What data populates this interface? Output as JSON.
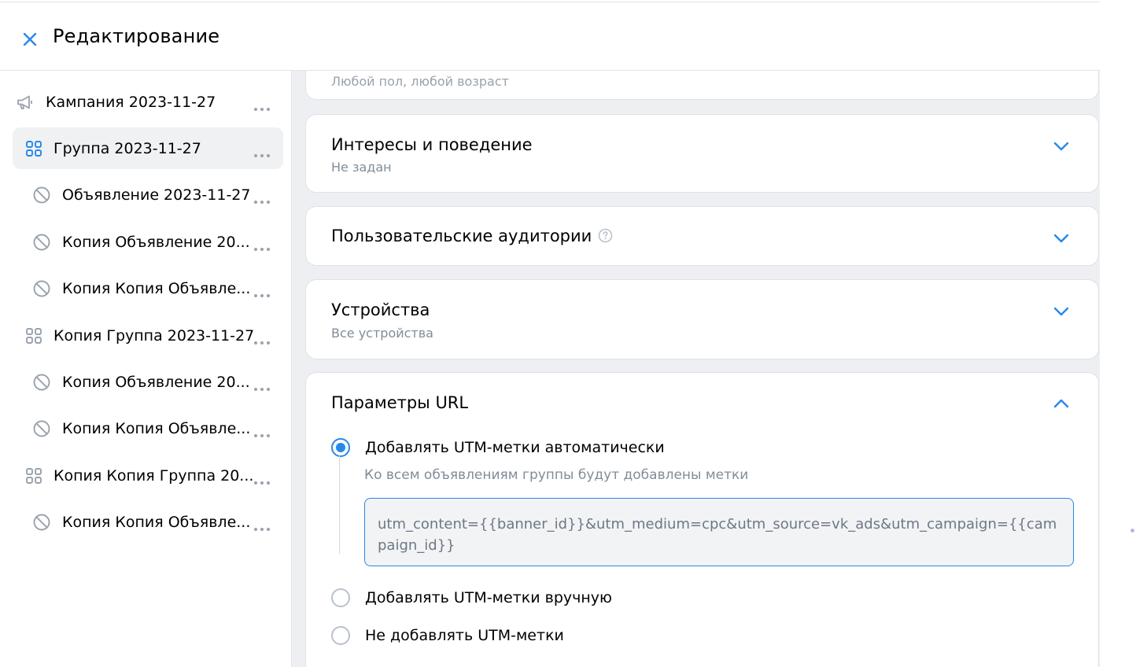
{
  "header": {
    "title": "Редактирование"
  },
  "sidebar": {
    "items": [
      {
        "label": "Кампания 2023-11-27",
        "icon": "megaphone-icon",
        "active": false
      },
      {
        "label": "Группа 2023-11-27",
        "icon": "grid-icon",
        "active": true
      },
      {
        "label": "Объявление 2023-11-27",
        "icon": "blocked-icon",
        "active": false
      },
      {
        "label": "Копия Объявление 20...",
        "icon": "blocked-icon",
        "active": false
      },
      {
        "label": "Копия Копия Объявле...",
        "icon": "blocked-icon",
        "active": false
      },
      {
        "label": "Копия Группа 2023-11-27",
        "icon": "grid-icon",
        "active": false
      },
      {
        "label": "Копия Объявление 20...",
        "icon": "blocked-icon",
        "active": false
      },
      {
        "label": "Копия Копия Объявле...",
        "icon": "blocked-icon",
        "active": false
      },
      {
        "label": "Копия Копия Группа 20...",
        "icon": "grid-icon",
        "active": false
      },
      {
        "label": "Копия Копия Объявле...",
        "icon": "blocked-icon",
        "active": false
      }
    ]
  },
  "main": {
    "demography_card": {
      "subtitle": "Любой пол, любой возраст"
    },
    "interests_card": {
      "title": "Интересы и поведение",
      "subtitle": "Не задан",
      "expanded": false
    },
    "audiences_card": {
      "title": "Пользовательские аудитории",
      "expanded": false
    },
    "devices_card": {
      "title": "Устройства",
      "subtitle": "Все устройства",
      "expanded": false
    },
    "url_card": {
      "title": "Параметры URL",
      "expanded": true,
      "options": [
        {
          "label": "Добавлять UTM-метки автоматически",
          "selected": true
        },
        {
          "label": "Добавлять UTM-метки вручную",
          "selected": false
        },
        {
          "label": "Не добавлять UTM-метки",
          "selected": false
        }
      ],
      "hint": "Ко всем объявлениям группы будут добавлены метки",
      "utm_value": "utm_content={{banner_id}}&utm_medium=cpc&utm_source=vk_ads&utm_campaign={{campaign_id}}"
    }
  },
  "colors": {
    "accent": "#2688eb",
    "background": "#eeeff2",
    "secondary_text": "#818c99",
    "icon_gray": "#99a2ad"
  }
}
